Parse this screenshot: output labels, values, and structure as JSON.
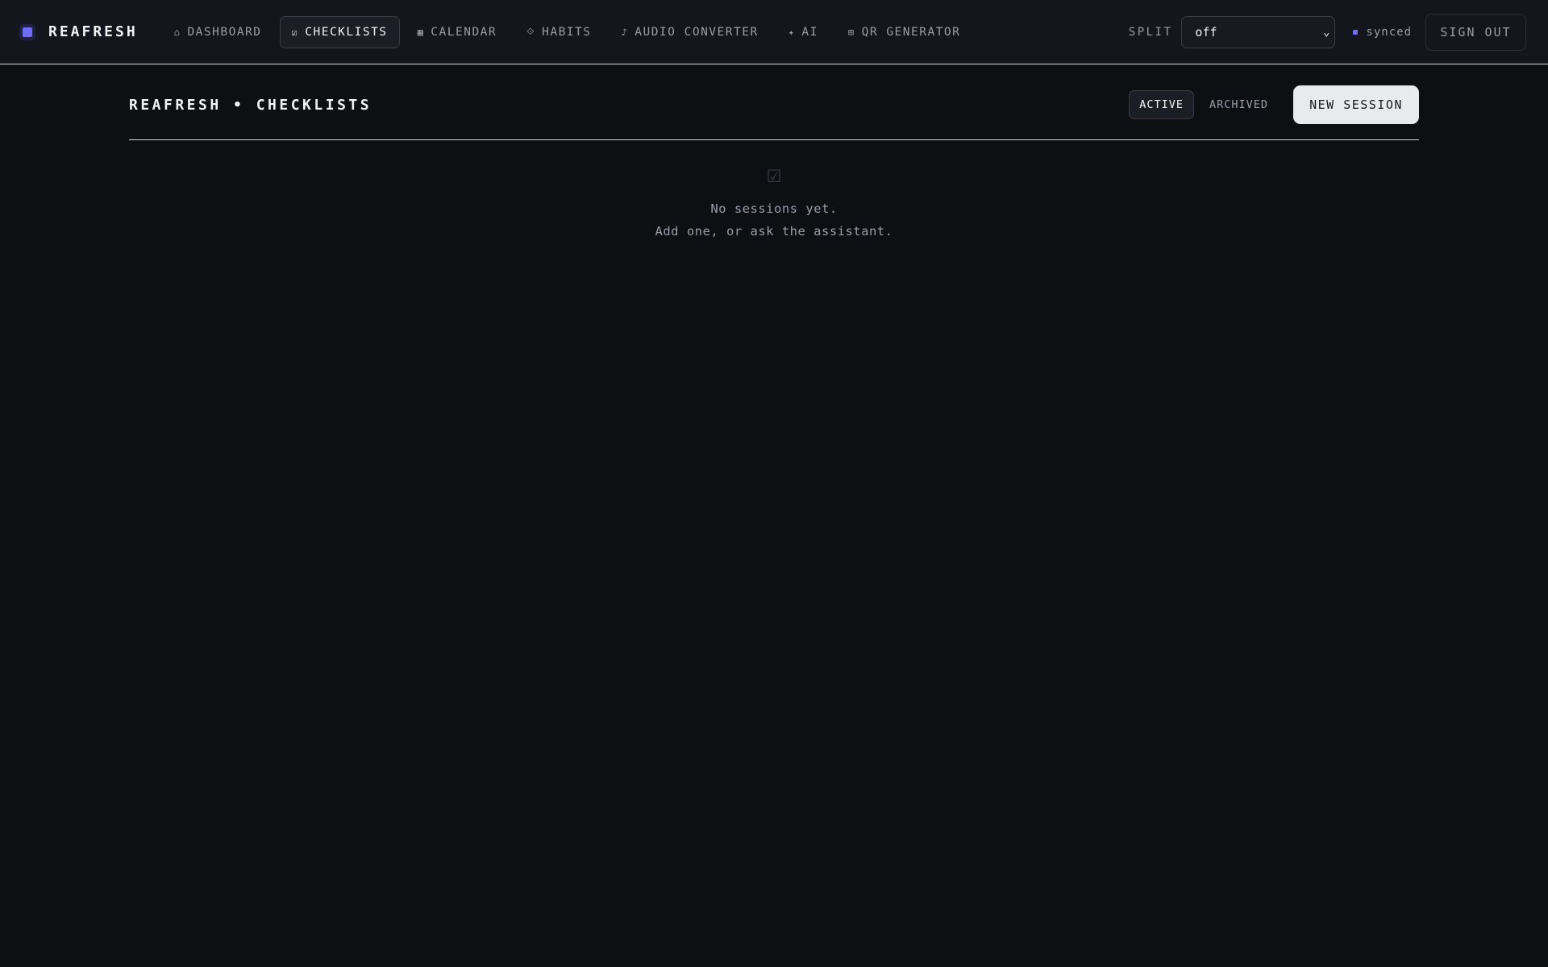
{
  "brand": {
    "name": "REAFRESH",
    "logo_color": "#6f6cf7"
  },
  "nav": {
    "items": [
      {
        "icon": "⌂",
        "icon_name": "home-icon",
        "label": "DASHBOARD"
      },
      {
        "icon": "☑",
        "icon_name": "checkbox-icon",
        "label": "CHECKLISTS"
      },
      {
        "icon": "▦",
        "icon_name": "calendar-icon",
        "label": "CALENDAR"
      },
      {
        "icon": "⟐",
        "icon_name": "habits-icon",
        "label": "HABITS"
      },
      {
        "icon": "♪",
        "icon_name": "music-note-icon",
        "label": "AUDIO CONVERTER"
      },
      {
        "icon": "✦",
        "icon_name": "sparkle-icon",
        "label": "AI"
      },
      {
        "icon": "⊞",
        "icon_name": "qr-icon",
        "label": "QR GENERATOR"
      }
    ],
    "active": "CHECKLISTS"
  },
  "split": {
    "label": "SPLIT",
    "value": "off"
  },
  "sync": {
    "status": "synced",
    "color": "#6f6cf7"
  },
  "signout": {
    "label": "SIGN OUT"
  },
  "page": {
    "title": "REAFRESH • CHECKLISTS",
    "filters": {
      "active_label": "ACTIVE",
      "archived_label": "ARCHIVED",
      "selected": "ACTIVE"
    },
    "new_session_label": "NEW SESSION"
  },
  "empty_state": {
    "icon": "☑",
    "icon_name": "checkbox-icon",
    "line1": "No sessions yet.",
    "line2": "Add one, or ask the assistant."
  }
}
